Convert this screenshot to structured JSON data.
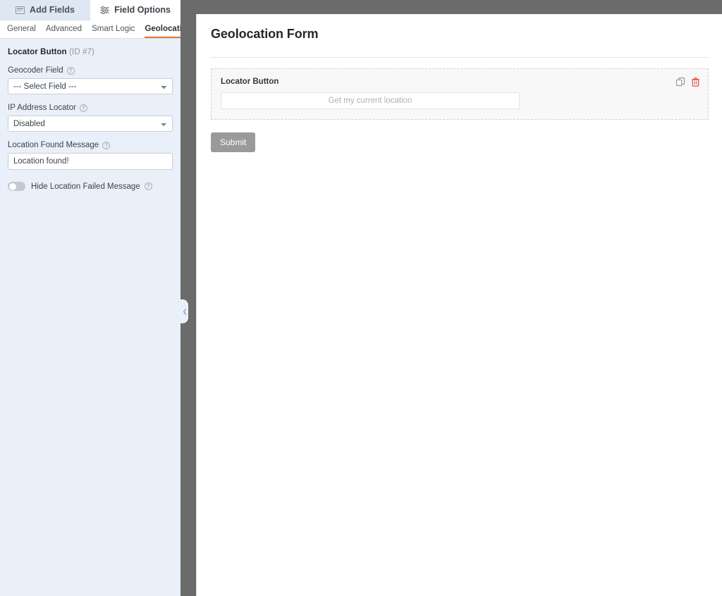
{
  "sidebar": {
    "panel_tabs": [
      {
        "label": "Add Fields",
        "icon": "fields-icon",
        "active": false
      },
      {
        "label": "Field Options",
        "icon": "sliders-icon",
        "active": true
      }
    ],
    "option_tabs": [
      {
        "label": "General",
        "active": false
      },
      {
        "label": "Advanced",
        "active": false
      },
      {
        "label": "Smart Logic",
        "active": false
      },
      {
        "label": "Geolocation",
        "active": true
      }
    ],
    "field_heading": {
      "name": "Locator Button",
      "id_label": "(ID #7)"
    },
    "options": {
      "geocoder_field": {
        "label": "Geocoder Field",
        "help": "?",
        "selected": "--- Select Field ---",
        "choices": [
          "--- Select Field ---"
        ]
      },
      "ip_address_locator": {
        "label": "IP Address Locator",
        "help": "?",
        "selected": "Disabled",
        "choices": [
          "Disabled"
        ]
      },
      "location_found_message": {
        "label": "Location Found Message",
        "help": "?",
        "value": "Location found!",
        "placeholder": ""
      },
      "hide_location_failed_message": {
        "label": "Hide Location Failed Message",
        "help": "?",
        "enabled": false
      }
    },
    "collapse_handle": {
      "icon": "chevron-left-icon"
    }
  },
  "preview": {
    "form_title": "Geolocation Form",
    "field": {
      "label": "Locator Button",
      "input_placeholder": "Get my current location",
      "actions": [
        {
          "name": "duplicate-field",
          "icon": "copy-icon",
          "color": "#8c9196"
        },
        {
          "name": "delete-field",
          "icon": "trash-icon",
          "color": "#e8443a"
        }
      ]
    },
    "submit_label": "Submit"
  },
  "colors": {
    "sidebar_bg": "#e9f0fa",
    "accent": "#e27730",
    "divider": "#6b6b6b",
    "submit_bg": "#9a9a9a",
    "delete_red": "#e8443a"
  }
}
